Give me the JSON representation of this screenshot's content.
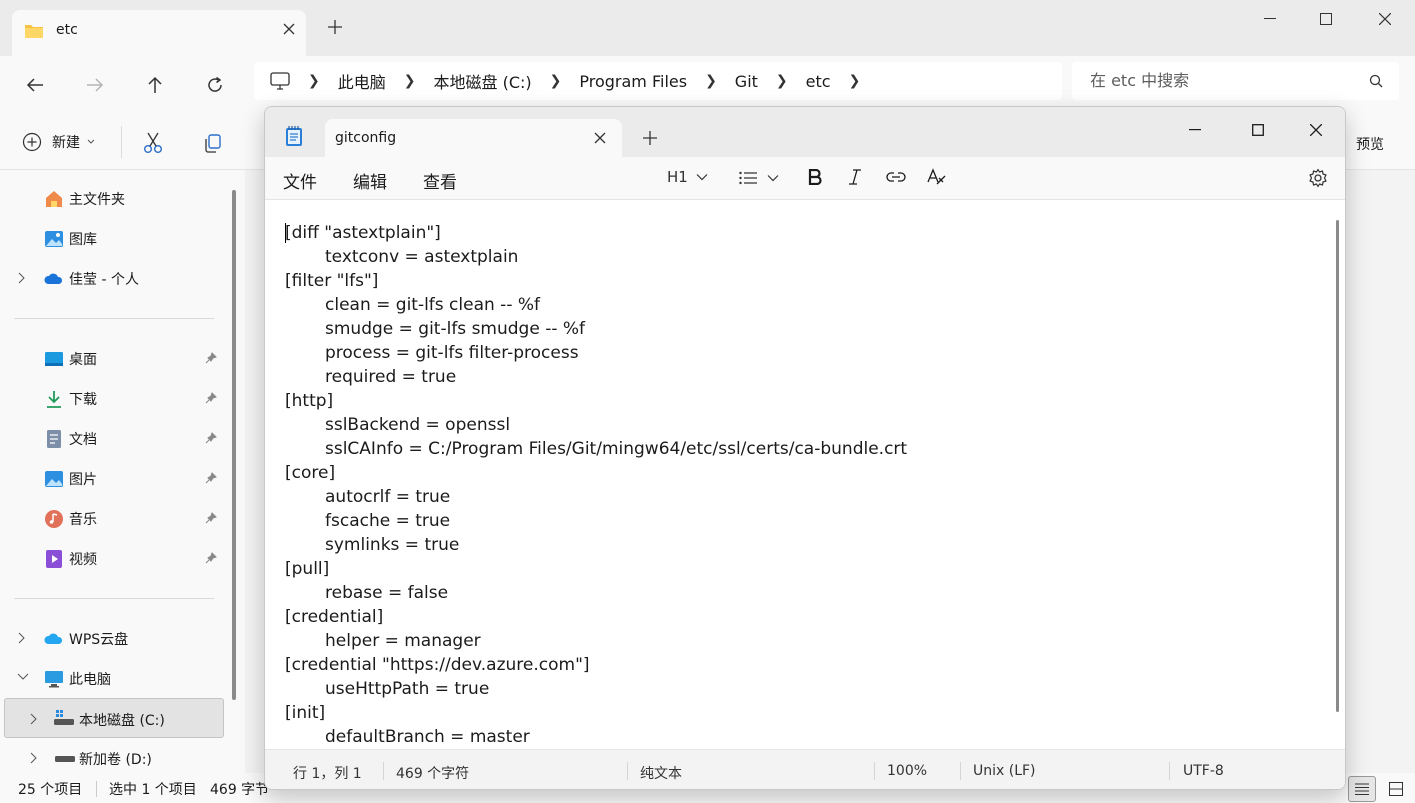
{
  "explorer": {
    "tab_title": "etc",
    "breadcrumb": [
      "此电脑",
      "本地磁盘 (C:)",
      "Program Files",
      "Git",
      "etc"
    ],
    "search_placeholder": "在 etc 中搜索",
    "toolbar": {
      "new_label": "新建",
      "preview_label": "预览"
    },
    "sidebar": {
      "quick": [
        {
          "label": "主文件夹",
          "icon": "home-icon"
        },
        {
          "label": "图库",
          "icon": "gallery-icon"
        },
        {
          "label": "佳莹 - 个人",
          "icon": "onedrive-icon"
        }
      ],
      "pinned": [
        {
          "label": "桌面",
          "icon": "desktop-icon"
        },
        {
          "label": "下载",
          "icon": "download-icon"
        },
        {
          "label": "文档",
          "icon": "documents-icon"
        },
        {
          "label": "图片",
          "icon": "pictures-icon"
        },
        {
          "label": "音乐",
          "icon": "music-icon"
        },
        {
          "label": "视频",
          "icon": "videos-icon"
        }
      ],
      "drives": [
        {
          "label": "WPS云盘",
          "icon": "cloud-icon"
        },
        {
          "label": "此电脑",
          "icon": "computer-icon"
        },
        {
          "label": "本地磁盘 (C:)",
          "icon": "drive-icon"
        },
        {
          "label": "新加卷 (D:)",
          "icon": "drive-icon"
        }
      ]
    },
    "status": {
      "count": "25 个项目",
      "selected": "选中 1 个项目",
      "size": "469 字节"
    }
  },
  "notepad": {
    "tab_title": "gitconfig",
    "menu": {
      "file": "文件",
      "edit": "编辑",
      "view": "查看"
    },
    "toolbar": {
      "heading": "H1"
    },
    "lines": [
      {
        "text": "[diff \"astextplain\"]",
        "indent": false
      },
      {
        "text": "textconv = astextplain",
        "indent": true
      },
      {
        "text": "[filter \"lfs\"]",
        "indent": false
      },
      {
        "text": "clean = git-lfs clean -- %f",
        "indent": true
      },
      {
        "text": "smudge = git-lfs smudge -- %f",
        "indent": true
      },
      {
        "text": "process = git-lfs filter-process",
        "indent": true
      },
      {
        "text": "required = true",
        "indent": true
      },
      {
        "text": "[http]",
        "indent": false
      },
      {
        "text": "sslBackend = openssl",
        "indent": true
      },
      {
        "text": "sslCAInfo = C:/Program Files/Git/mingw64/etc/ssl/certs/ca-bundle.crt",
        "indent": true
      },
      {
        "text": "[core]",
        "indent": false
      },
      {
        "text": "autocrlf = true",
        "indent": true
      },
      {
        "text": "fscache = true",
        "indent": true
      },
      {
        "text": "symlinks = true",
        "indent": true
      },
      {
        "text": "[pull]",
        "indent": false
      },
      {
        "text": "rebase = false",
        "indent": true
      },
      {
        "text": "[credential]",
        "indent": false
      },
      {
        "text": "helper = manager",
        "indent": true
      },
      {
        "text": "[credential \"https://dev.azure.com\"]",
        "indent": false
      },
      {
        "text": "useHttpPath = true",
        "indent": true
      },
      {
        "text": "[init]",
        "indent": false
      },
      {
        "text": "defaultBranch = master",
        "indent": true
      }
    ],
    "status": {
      "position": "行 1，列 1",
      "chars": "469 个字符",
      "format": "纯文本",
      "zoom": "100%",
      "line_ending": "Unix (LF)",
      "encoding": "UTF-8"
    }
  }
}
